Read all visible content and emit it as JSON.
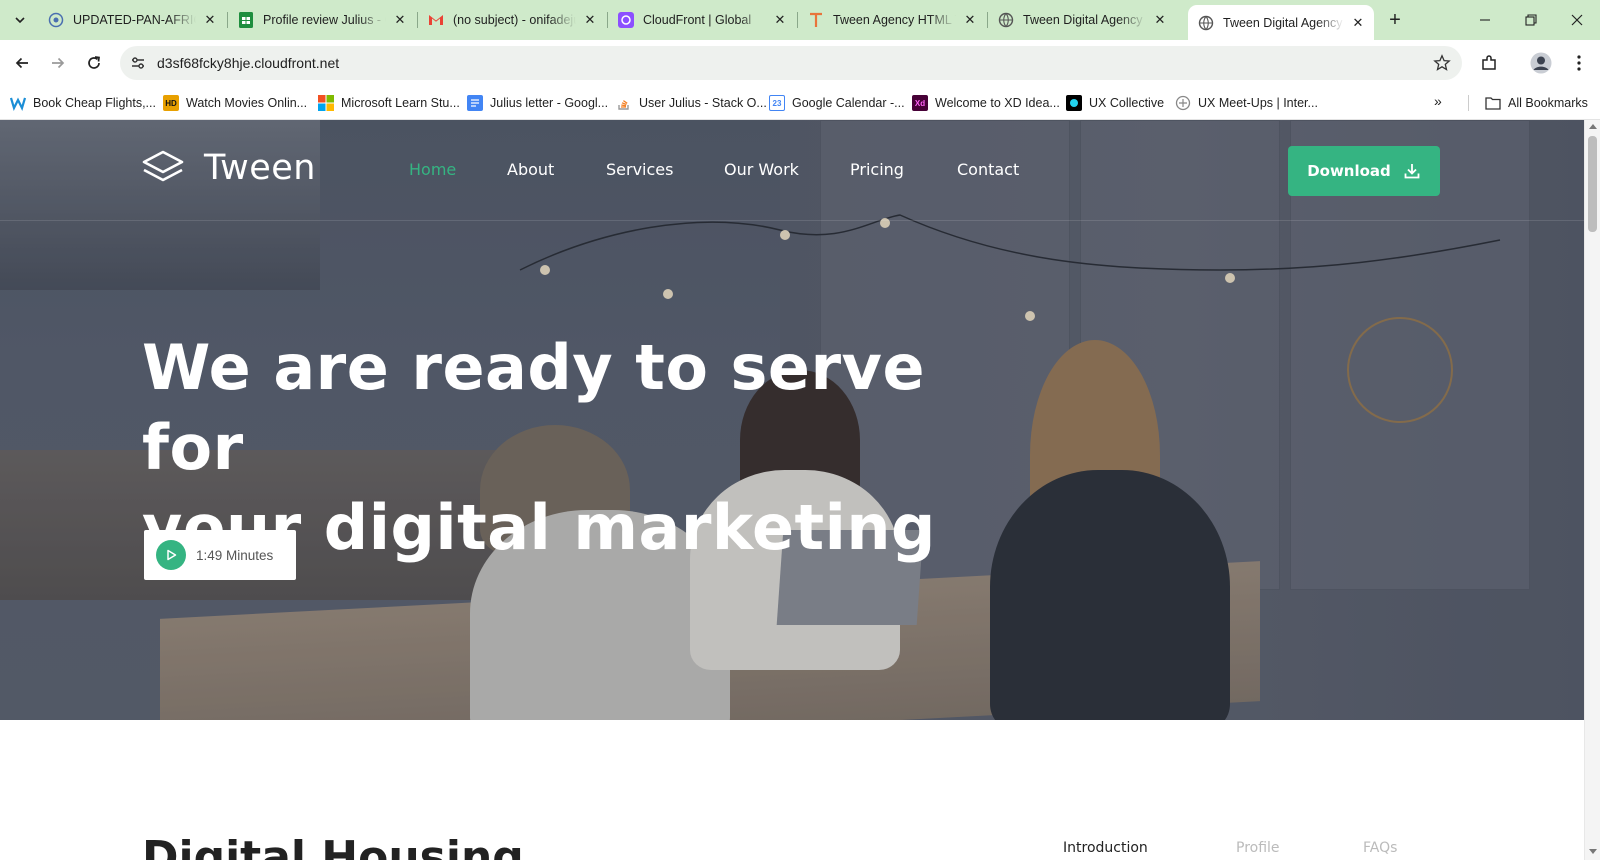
{
  "browser": {
    "tabs": [
      {
        "title": "UPDATED-PAN-AFRICAN",
        "icon": "google-docs-globe-icon"
      },
      {
        "title": "Profile review Julius - Google Sheets",
        "icon": "google-sheets-icon"
      },
      {
        "title": "(no subject) - onifadejulius",
        "icon": "gmail-icon"
      },
      {
        "title": "CloudFront | Global",
        "icon": "cloudfront-icon"
      },
      {
        "title": "Tween Agency HTML Template",
        "icon": "tween-t-icon"
      },
      {
        "title": "Tween Digital Agency HTML",
        "icon": "globe-icon"
      },
      {
        "title": "Tween Digital Agency HTML",
        "icon": "globe-icon"
      }
    ],
    "url": "d3sf68fcky8hje.cloudfront.net",
    "bookmarks": [
      {
        "label": "Book Cheap Flights,...",
        "icon": "wego-icon"
      },
      {
        "label": "Watch Movies Onlin...",
        "icon": "hd-icon"
      },
      {
        "label": "Microsoft Learn Stu...",
        "icon": "microsoft-icon"
      },
      {
        "label": "Julius letter - Googl...",
        "icon": "google-docs-icon"
      },
      {
        "label": "User Julius - Stack O...",
        "icon": "stackoverflow-icon"
      },
      {
        "label": "Google Calendar -...",
        "icon": "calendar-icon"
      },
      {
        "label": "Welcome to XD Idea...",
        "icon": "xd-icon"
      },
      {
        "label": "UX Collective",
        "icon": "uxcollective-icon"
      },
      {
        "label": "UX Meet-Ups | Inter...",
        "icon": "meetup-icon"
      }
    ],
    "all_bookmarks": "All Bookmarks",
    "more_bookmarks": "»"
  },
  "site": {
    "brand": "Tween",
    "nav": [
      "Home",
      "About",
      "Services",
      "Our Work",
      "Pricing",
      "Contact"
    ],
    "active_nav": "Home",
    "download_label": "Download",
    "headline_line1": "We are ready to serve for",
    "headline_line2": "your digital marketing",
    "video_length": "1:49 Minutes",
    "section_title": "Digital Housing",
    "section_tabs": [
      "Introduction",
      "Profile",
      "FAQs"
    ],
    "accent_color": "#35b482"
  }
}
